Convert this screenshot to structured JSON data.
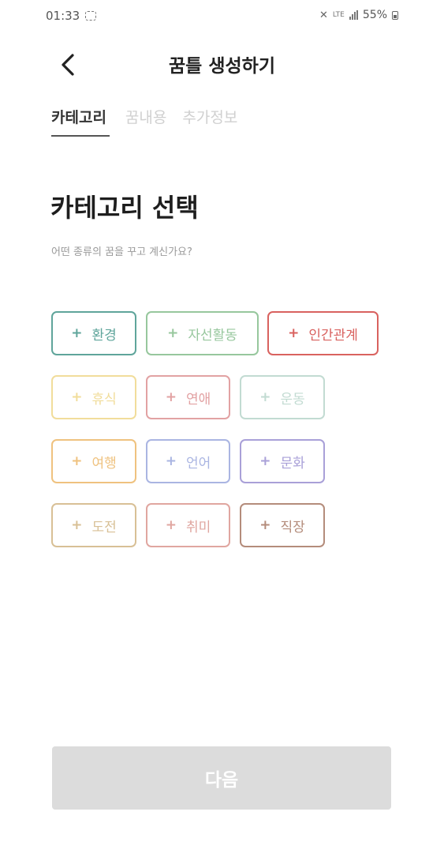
{
  "status_bar": {
    "time": "01:33",
    "battery": "55%",
    "network": "LTE",
    "icons": [
      "screenshot-icon",
      "mute-icon",
      "lte-icon",
      "signal-icon",
      "battery-icon"
    ]
  },
  "header": {
    "back_icon": "chevron-left-icon",
    "title": "꿈틀 생성하기"
  },
  "tabs": [
    "카테고리",
    "꿈내용",
    "추가정보"
  ],
  "active_tab": "카테고리",
  "section": {
    "title": "카테고리 선택",
    "subtitle": "어떤 종류의 꿈을 꾸고 계신가요?"
  },
  "categories": [
    {
      "label": "환경",
      "color": "#5fa59b"
    },
    {
      "label": "자선활동",
      "color": "#97c79d"
    },
    {
      "label": "인간관계",
      "color": "#d9625f"
    },
    {
      "label": "휴식",
      "color": "#f1dd9b"
    },
    {
      "label": "연애",
      "color": "#e2a2a3"
    },
    {
      "label": "운동",
      "color": "#c2dbd2"
    },
    {
      "label": "여행",
      "color": "#efc27f"
    },
    {
      "label": "언어",
      "color": "#aab5e2"
    },
    {
      "label": "문화",
      "color": "#a9a0d8"
    },
    {
      "label": "도전",
      "color": "#d8c096"
    },
    {
      "label": "취미",
      "color": "#e0a6a0"
    },
    {
      "label": "직장",
      "color": "#b48c7b"
    }
  ],
  "category_plus": "+",
  "next_button": {
    "label": "다음",
    "bg_color": "#dcdcdc"
  }
}
